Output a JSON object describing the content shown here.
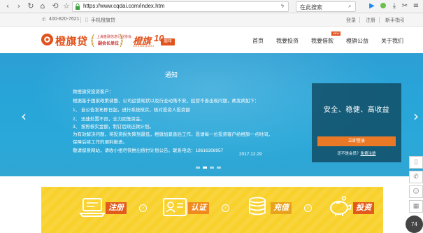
{
  "browser": {
    "url": "https://www.cqdai.com/index.htm",
    "search_placeholder": "在此搜索"
  },
  "topbar": {
    "phone": "400-820-7621",
    "mobile_app": "手机橙旗贷",
    "login": "登录",
    "register": "注册",
    "guide": "新手指引"
  },
  "header": {
    "logo_text": "橙旗贷",
    "badge_line1": "上海金融信息行业协会",
    "badge_line2": "副会长单位",
    "anniv_brand": "橙旗",
    "anniv_en": "CHENGQIDAI",
    "anniv_number": "10",
    "anniv_suffix": "周年",
    "menu": [
      "首页",
      "我要投资",
      "我要借款",
      "橙旗公益",
      "关于我们"
    ],
    "new_tag": "NEW"
  },
  "banner": {
    "notice_title": "通知",
    "notice_lines": [
      "致橙旗贷投资客户：",
      "根据基于国家政策调整、公司运营现状以及行业动荡不安，经营不善出现问题，故发病如下：",
      "1、 自公告发布即日起，进行系统核实，核对投资人投资额",
      "2、 迅速处置不良，全力回笼资金。",
      "3、 按照核实金额，制订后续还款计划。",
      "  为有效解决问题，将投资损失降到最低，橙旗加紧善后工作，恳请每一位投资客户给橙旗一点时间，",
      "保障后续工作的顺利推进。",
      "  敬请留意网站，请收小组尽快推出偿付计划公告。联系电话：18616308957"
    ],
    "notice_date": "2017.12.29",
    "slogan": "安全、稳健、高收益",
    "login_button": "立即登录",
    "no_account": "还不是会员？",
    "register_link": "免费注册"
  },
  "features": [
    "注册",
    "认证",
    "充值",
    "投资"
  ],
  "fps": "74"
}
